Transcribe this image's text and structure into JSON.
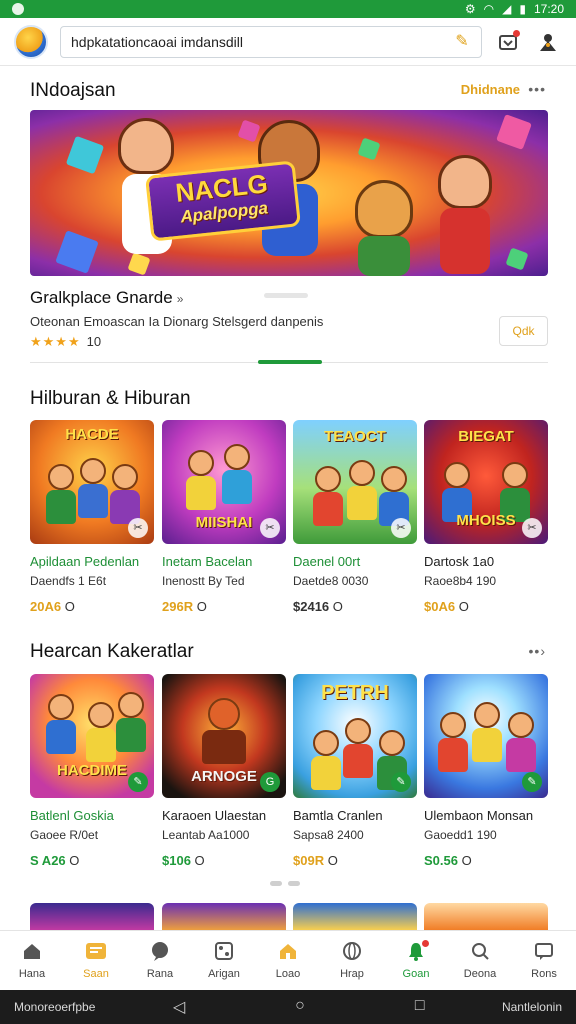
{
  "status_bar": {
    "time": "17:20",
    "icons": [
      "settings-icon",
      "wifi-icon",
      "signal-icon",
      "battery-icon"
    ]
  },
  "topbar": {
    "search_value": "hdpkatationcaoai imdansdill",
    "icons": [
      "app-logo",
      "mic-icon",
      "cart-icon",
      "profile-icon"
    ]
  },
  "featured": {
    "title": "INdoajsan",
    "see_more": "Dhidnane",
    "banner_title": "NACLG",
    "banner_subtitle": "Apalpopga",
    "banner_small": "",
    "app_name": "Gralkplace Gnarde",
    "app_desc": "Oteonan Emoascan Ia Dionarg Stelsgerd danpenis",
    "rating_stars": "★★★★",
    "rating_value": "10",
    "button_label": "Qdk"
  },
  "section1": {
    "title": "Hilburan & Hiburan",
    "cards": [
      {
        "art": "HACDE",
        "name": "Apildaan Pedenlan",
        "sub": "Daendfs 1 E6t",
        "price": "20A6",
        "currency_suffix": "O",
        "name_color": "green",
        "price_color": "#e0a11c"
      },
      {
        "art": "MIISHAI",
        "name": "Inetam Bacelan",
        "sub": "Inenostt By Ted",
        "price": "296R",
        "currency_suffix": "O",
        "name_color": "green",
        "price_color": "#e0a11c"
      },
      {
        "art": "TEAOCT",
        "name": "Daenel 00rt",
        "sub": "Daetde8 0030",
        "price": "$2416",
        "currency_suffix": "O",
        "name_color": "green",
        "price_color": "#333333"
      },
      {
        "art": "MHOISS",
        "name": "Dartosk 1a0",
        "sub": "Raoe8b4 190",
        "price": "$0A6",
        "currency_suffix": "O",
        "name_color": "dark",
        "price_color": "#e0a11c"
      }
    ]
  },
  "section2": {
    "title": "Hearcan Kakeratlar",
    "cards": [
      {
        "art": "HACDIME",
        "name": "Batlenl Goskia",
        "sub": "Gaoee R/0et",
        "price": "S A26",
        "currency_suffix": "O",
        "name_color": "green",
        "price_color": "#1f9a3a"
      },
      {
        "art": "ARNOGE",
        "name": "Karaoen Ulaestan",
        "sub": "Leantab Aa1000",
        "price": "$106",
        "currency_suffix": "O",
        "name_color": "dark",
        "price_color": "#1f9a3a"
      },
      {
        "art": "PETRH",
        "name": "Bamtla Cranlen",
        "sub": "Sapsa8 2400",
        "price": "$09R",
        "currency_suffix": "O",
        "name_color": "dark",
        "price_color": "#e0a11c"
      },
      {
        "art": "",
        "name": "Ulembaon Monsan",
        "sub": "Gaoedd1 190",
        "price": "S0.56",
        "currency_suffix": "O",
        "name_color": "dark",
        "price_color": "#1f9a3a"
      }
    ]
  },
  "bottom_nav": [
    {
      "label": "Hana",
      "icon": "home-icon",
      "state": "normal"
    },
    {
      "label": "Saan",
      "icon": "store-icon",
      "state": "yellow"
    },
    {
      "label": "Rana",
      "icon": "chat-icon",
      "state": "normal"
    },
    {
      "label": "Arigan",
      "icon": "games-icon",
      "state": "normal"
    },
    {
      "label": "Loao",
      "icon": "house-icon",
      "state": "normal"
    },
    {
      "label": "Hrap",
      "icon": "globe-icon",
      "state": "normal"
    },
    {
      "label": "Goan",
      "icon": "bell-icon",
      "state": "green",
      "dot": true
    },
    {
      "label": "Deona",
      "icon": "search-icon",
      "state": "normal"
    },
    {
      "label": "Rons",
      "icon": "message-icon",
      "state": "normal"
    }
  ],
  "system_bar": {
    "left_text": "Monoreoerfpbe",
    "right_text": "Nantlelonin"
  },
  "colors": {
    "accent_green": "#1f9a3a",
    "accent_yellow": "#e0a11c",
    "status_bar": "#1f9a3a"
  }
}
